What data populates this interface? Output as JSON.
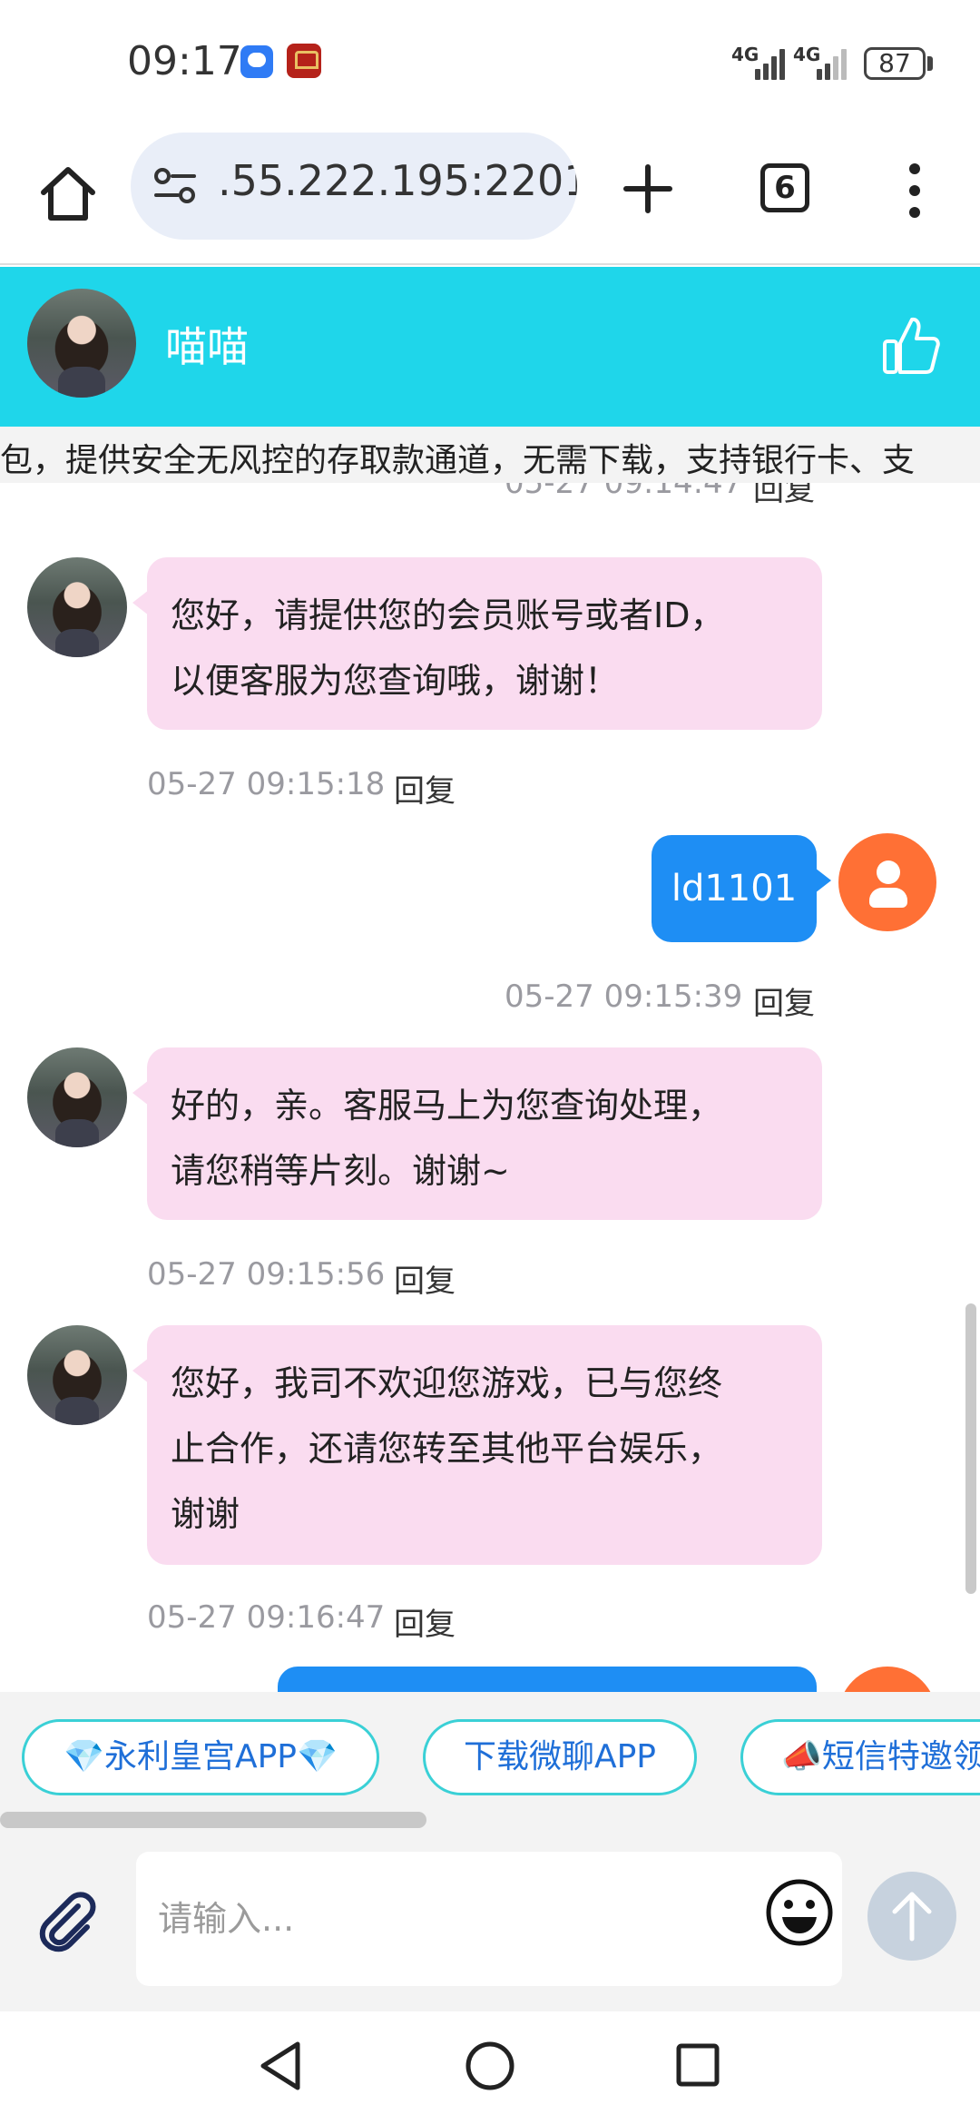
{
  "status_bar": {
    "time": "09:17",
    "network_1": "4G",
    "network_2": "4G",
    "battery": "87"
  },
  "browser": {
    "url": ".55.222.195:2201",
    "tab_count": "6"
  },
  "chat": {
    "contact_name": "喵喵",
    "marquee": "包，提供安全无风控的存取款通道，无需下载，支持银行卡、支",
    "messages": [
      {
        "from": "agent",
        "lines": [
          "您好，请提供您的会员账号或者ID，",
          "以便客服为您查询哦，谢谢！"
        ],
        "time": "05-27 09:15:18",
        "reply": "回复"
      },
      {
        "from": "user",
        "text": "ld1101",
        "time": "05-27 09:15:39",
        "reply": "回复"
      },
      {
        "from": "agent",
        "lines": [
          "好的，亲。客服马上为您查询处理，",
          "请您稍等片刻。谢谢~"
        ],
        "time": "05-27 09:15:56",
        "reply": "回复"
      },
      {
        "from": "agent",
        "lines": [
          "您好，我司不欢迎您游戏，已与您终",
          "止合作，还请您转至其他平台娱乐，",
          "谢谢"
        ],
        "time": "05-27 09:16:47",
        "reply": "回复"
      }
    ]
  },
  "quick_buttons": [
    "💎永利皇宫APP💎",
    "下载微聊APP",
    "📣短信特邀领"
  ],
  "input": {
    "placeholder": "请输入..."
  },
  "colors": {
    "header": "#1fd6ea",
    "incoming_bubble": "#fadcf0",
    "outgoing_bubble": "#1e8ef4",
    "user_avatar": "#ff7035"
  }
}
